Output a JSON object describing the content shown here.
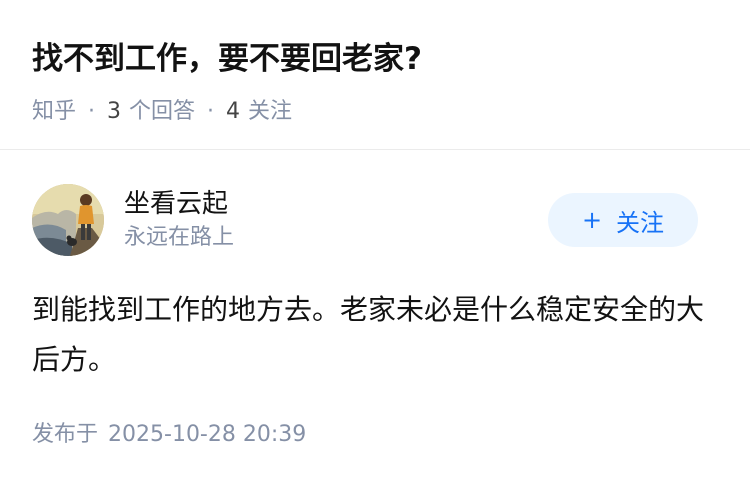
{
  "question": {
    "title": "找不到工作，要不要回老家?",
    "source": "知乎",
    "answer_count": "3",
    "answer_label": "个回答",
    "follower_count": "4",
    "follower_label": "关注"
  },
  "answer": {
    "author_name": "坐看云起",
    "author_headline": "永远在路上",
    "follow_button_plus": "+",
    "follow_button_label": "关注",
    "content": "到能找到工作的地方去。老家未必是什么稳定安全的大后方。",
    "published_prefix": "发布于",
    "published_time": "2025-10-28 20:39"
  },
  "colors": {
    "accent": "#1772f6",
    "follow_bg": "#ebf5ff",
    "meta_gray": "#8590a6"
  }
}
